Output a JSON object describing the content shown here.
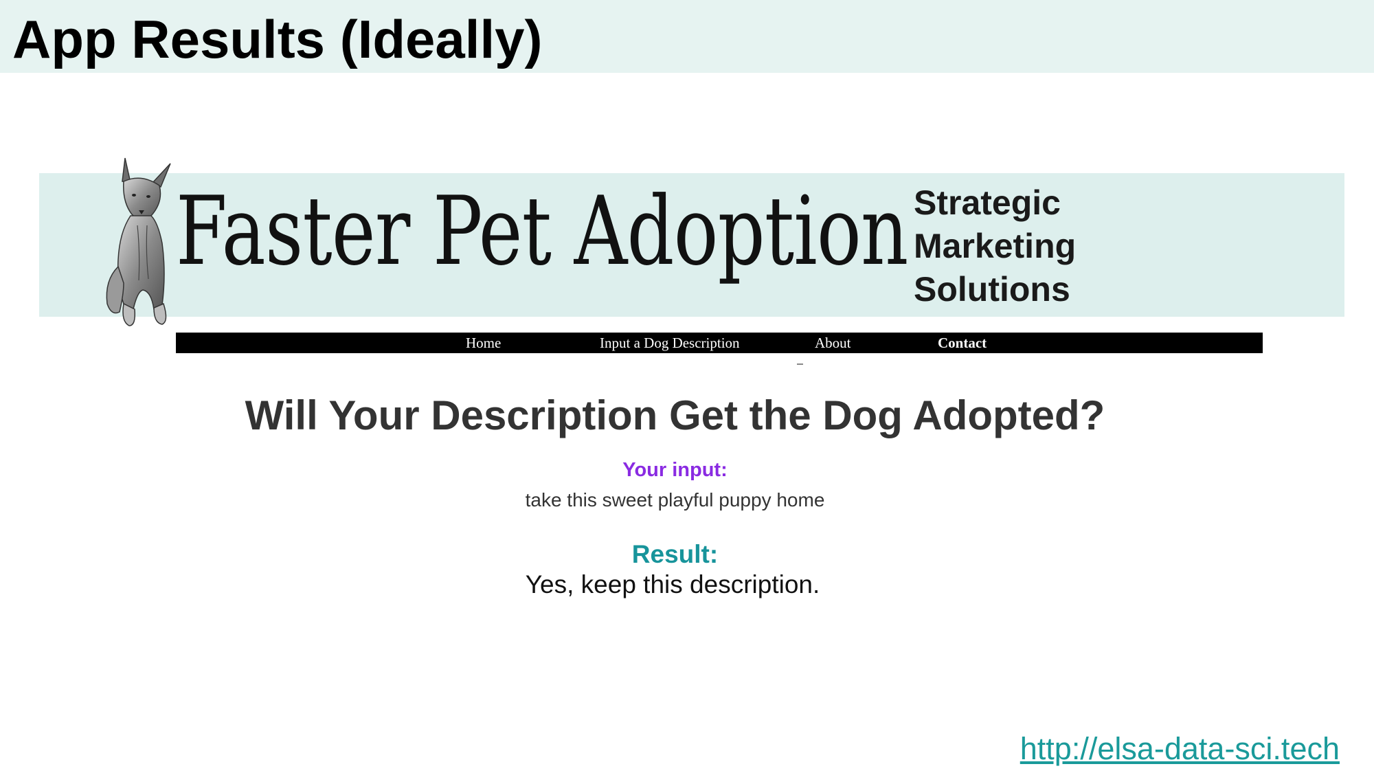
{
  "slide": {
    "title": "App Results (Ideally)",
    "footer_link": "http://elsa-data-sci.tech"
  },
  "banner": {
    "title": "Faster Pet Adoption",
    "tagline": [
      "Strategic",
      "Marketing",
      "Solutions"
    ],
    "logo_icon": "dog-sketch-icon"
  },
  "nav": {
    "items": [
      {
        "label": "Home"
      },
      {
        "label": "Input a Dog Description"
      },
      {
        "label": "About"
      },
      {
        "label": "Contact"
      }
    ]
  },
  "main": {
    "heading": "Will Your Description Get the Dog Adopted?",
    "input_label": "Your input:",
    "input_value": "take this sweet playful puppy home",
    "result_label": "Result:",
    "result_value": "Yes, keep this description."
  },
  "colors": {
    "title_band": "#e6f3f1",
    "banner_bg": "#ddefed",
    "input_label": "#8a2be2",
    "result_label": "#17949b",
    "link": "#1a9a9a",
    "navbar": "#000000"
  }
}
